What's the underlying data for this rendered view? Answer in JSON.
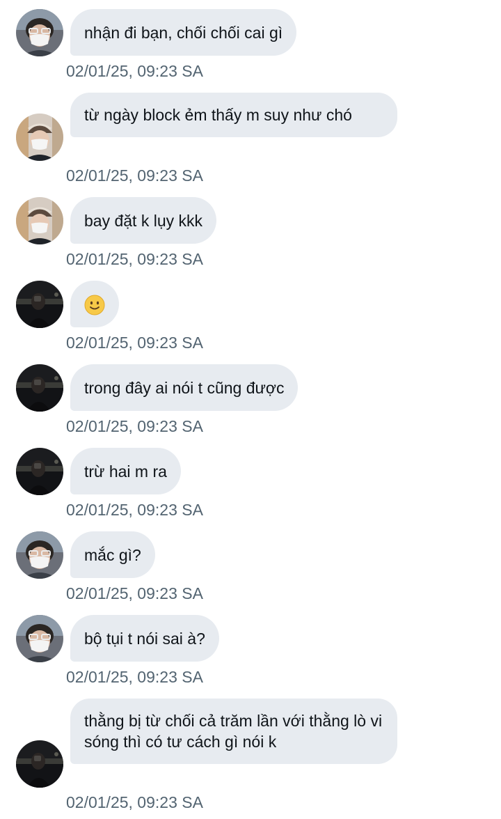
{
  "conversation": {
    "messages": [
      {
        "avatar": "masked-white-glasses",
        "text": "nhận đi bạn, chối chối cai gì",
        "time": "02/01/25, 09:23 SA"
      },
      {
        "avatar": "masked-cap",
        "text": "từ ngày block ẻm thấy m suy như chó",
        "time": "02/01/25, 09:23 SA"
      },
      {
        "avatar": "masked-cap",
        "text": "bay đặt k lụy kkk",
        "time": "02/01/25, 09:23 SA"
      },
      {
        "avatar": "dark-night",
        "text": "",
        "emoji": "slightly-smiling-face-icon",
        "time": "02/01/25, 09:23 SA"
      },
      {
        "avatar": "dark-night",
        "text": "trong đây ai nói t cũng được",
        "time": "02/01/25, 09:23 SA"
      },
      {
        "avatar": "dark-night",
        "text": "trừ hai m ra",
        "time": "02/01/25, 09:23 SA"
      },
      {
        "avatar": "masked-white-glasses",
        "text": "mắc gì?",
        "time": "02/01/25, 09:23 SA"
      },
      {
        "avatar": "masked-white-glasses",
        "text": "bộ tụi t nói sai à?",
        "time": "02/01/25, 09:23 SA"
      },
      {
        "avatar": "dark-night",
        "text": "thằng bị từ chối cả trăm lần với thằng lò vi sóng thì có tư cách gì nói k",
        "time": "02/01/25, 09:23 SA"
      }
    ]
  },
  "colors": {
    "bubble": "#e7ebf0",
    "text": "#0f1419",
    "timestamp": "#536471",
    "emoji": "#f7c948"
  }
}
